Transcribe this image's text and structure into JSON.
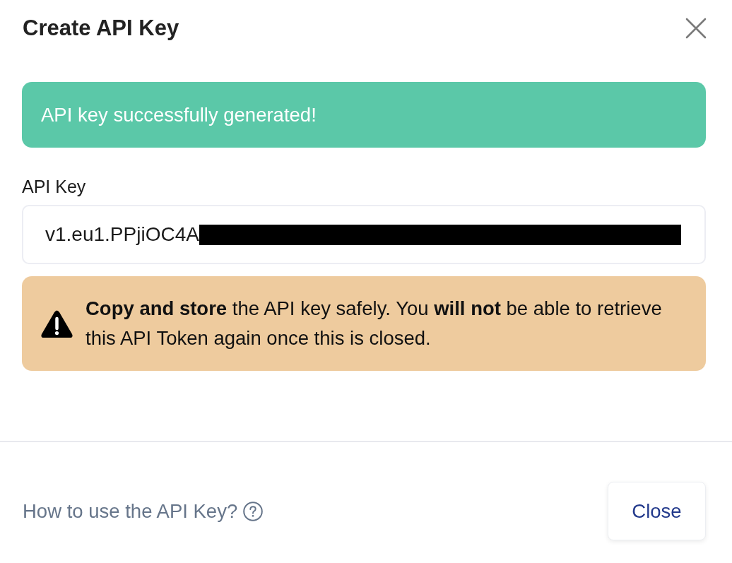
{
  "dialog": {
    "title": "Create API Key"
  },
  "success_banner": {
    "text": "API key successfully generated!"
  },
  "api_key_field": {
    "label": "API Key",
    "value": "v1.eu1.PPjiOC4A",
    "redacted": true
  },
  "warning": {
    "text": "**Copy and store** the API key safely. You **will not** be able to retrieve this API Token again once this is closed."
  },
  "footer": {
    "help_link": "How to use the API Key?",
    "buttons": [
      {
        "label": "Close"
      }
    ]
  }
}
